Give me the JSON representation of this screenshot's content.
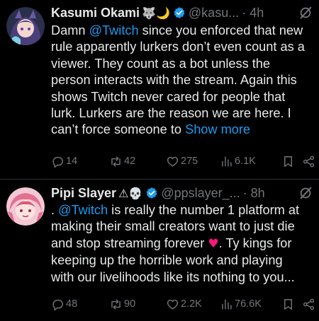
{
  "tweets": [
    {
      "author_name": "Kasumi Okami",
      "name_emoji": "🐺🌙",
      "handle": "@kasu...",
      "time": "· 4h",
      "lines": [
        {
          "pre": "Damn ",
          "mention": "@Twitch",
          "post": " since you enforced that new"
        },
        {
          "text": "rule apparently lurkers don’t even count as a"
        },
        {
          "text": "viewer. They count as a bot unless the"
        },
        {
          "text": "person interacts with the stream. Again this"
        },
        {
          "text": "shows Twitch never cared for people that"
        },
        {
          "text": "lurk. Lurkers are the reason we are here. I"
        },
        {
          "text": "can’t force someone to ",
          "show_more": "Show more"
        }
      ],
      "stats": {
        "replies": "14",
        "reposts": "42",
        "likes": "275",
        "views": "6.1K"
      }
    },
    {
      "author_name": "Pipi Slayer",
      "name_emoji": "⚠💀",
      "handle": "@ppslayer_...",
      "time": "· 8h",
      "lines": [
        {
          "pre": ". ",
          "mention": "@Twitch",
          "post": " is really the number 1 platform at"
        },
        {
          "text": "making their small creators want to just die"
        },
        {
          "text": "and stop streaming forever ",
          "heart": "♥",
          "after": ". Ty kings for"
        },
        {
          "text": "keeping up the horrible work and playing"
        },
        {
          "text": "with our livelihoods like its nothing to you..."
        }
      ],
      "stats": {
        "replies": "48",
        "reposts": "90",
        "likes": "2.2K",
        "views": "76.6K"
      }
    }
  ],
  "colors": {
    "background": "#000000",
    "text": "#e7e9ea",
    "muted": "#71767b",
    "link": "#1d9bf0",
    "verified": "#1d9bf0",
    "heart": "#f91880"
  },
  "icons": [
    "verified-badge-icon",
    "grok-icon",
    "reply-icon",
    "repost-icon",
    "like-icon",
    "views-icon",
    "bookmark-icon",
    "share-icon"
  ]
}
